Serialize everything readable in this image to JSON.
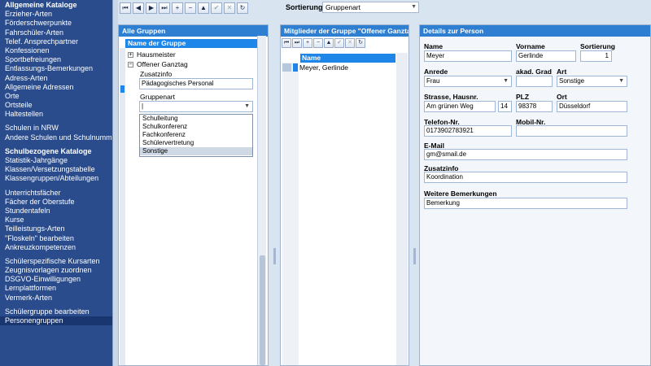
{
  "sidebar": {
    "items": [
      {
        "label": "Allgemeine Kataloge",
        "header": true
      },
      {
        "label": "Erzieher-Arten"
      },
      {
        "label": "Förderschwerpunkte"
      },
      {
        "label": "Fahrschüler-Arten"
      },
      {
        "label": "Telef. Ansprechpartner"
      },
      {
        "label": "Konfessionen"
      },
      {
        "label": "Sportbefreiungen"
      },
      {
        "label": "Entlassungs-Bemerkungen"
      },
      {
        "label": "Adress-Arten"
      },
      {
        "label": "Allgemeine Adressen"
      },
      {
        "label": "Orte"
      },
      {
        "label": "Ortsteile"
      },
      {
        "label": "Haltestellen"
      },
      {
        "gap": true
      },
      {
        "label": "Schulen in NRW"
      },
      {
        "label": "Andere Schulen und Schulnummern"
      },
      {
        "gap": true
      },
      {
        "label": "Schulbezogene Kataloge",
        "header": true
      },
      {
        "label": "Statistik-Jahrgänge"
      },
      {
        "label": "Klassen/Versetzungstabelle"
      },
      {
        "label": "Klassengruppen/Abteilungen"
      },
      {
        "gap": true
      },
      {
        "label": "Unterrichtsfächer"
      },
      {
        "label": "Fächer der Oberstufe"
      },
      {
        "label": "Stundentafeln"
      },
      {
        "label": "Kurse"
      },
      {
        "label": "Teilleistungs-Arten"
      },
      {
        "label": "\"Floskeln\" bearbeiten"
      },
      {
        "label": "Ankreuzkompetenzen"
      },
      {
        "gap": true
      },
      {
        "label": "Schülerspezifische Kursarten"
      },
      {
        "label": "Zeugnisvorlagen zuordnen"
      },
      {
        "label": "DSGVO-Einwilligungen"
      },
      {
        "label": "Lernplattformen"
      },
      {
        "label": "Vermerk-Arten"
      },
      {
        "gap": true
      },
      {
        "label": "Schülergruppe bearbeiten"
      },
      {
        "label": "Personengruppen",
        "selected": true
      }
    ]
  },
  "toolbar": {
    "buttons": [
      "⏮",
      "◀",
      "▶",
      "⏭",
      "+",
      "−",
      "▲",
      "✔",
      "✕",
      "↻"
    ],
    "sort_label": "Sortierung",
    "sort_value": "Gruppenart"
  },
  "groups_panel": {
    "title": "Alle Gruppen",
    "column": "Name der Gruppe",
    "tree": [
      {
        "label": "Hausmeister",
        "expander": "+"
      },
      {
        "label": "Offener Ganztag",
        "expander": "−"
      }
    ],
    "zusatzinfo_label": "Zusatzinfo",
    "zusatzinfo_value": "Pädagogisches Personal",
    "gruppenart_label": "Gruppenart",
    "gruppenart_value": "|",
    "options": [
      "Schulleitung",
      "Schulkonferenz",
      "Fachkonferenz",
      "Schülervertretung",
      "Sonstige"
    ],
    "selected_option": "Sonstige"
  },
  "members_panel": {
    "title": "Mitglieder der Gruppe \"Offener Ganztag\"",
    "column": "Name",
    "toolbar": [
      "⏮",
      "⏭",
      "+",
      "−",
      "▲",
      "✔",
      "✕",
      "↻"
    ],
    "rows": [
      "Meyer, Gerlinde"
    ]
  },
  "details": {
    "title": "Details zur Person",
    "name_label": "Name",
    "name": "Meyer",
    "vorname_label": "Vorname",
    "vorname": "Gerlinde",
    "sortierung_label": "Sortierung",
    "sortierung": "1",
    "anrede_label": "Anrede",
    "anrede": "Frau",
    "grad_label": "akad. Grad",
    "grad": "",
    "art_label": "Art",
    "art": "Sonstige",
    "strasse_label": "Strasse, Hausnr.",
    "strasse": "Am grünen Weg",
    "hausnr": "14",
    "plz_label": "PLZ",
    "plz": "98378",
    "ort_label": "Ort",
    "ort": "Düsseldorf",
    "telefon_label": "Telefon-Nr.",
    "telefon": "0173902783921",
    "mobil_label": "Mobil-Nr.",
    "mobil": "",
    "email_label": "E-Mail",
    "email": "gm@smail.de",
    "zusatz_label": "Zusatzinfo",
    "zusatz": "Koordination",
    "bem_label": "Weitere Bemerkungen",
    "bem": "Bemerkung"
  },
  "colors": {
    "sidebar": "#2a4c8c",
    "panel_header": "#2e7ed2",
    "column_header": "#1e86e8"
  }
}
